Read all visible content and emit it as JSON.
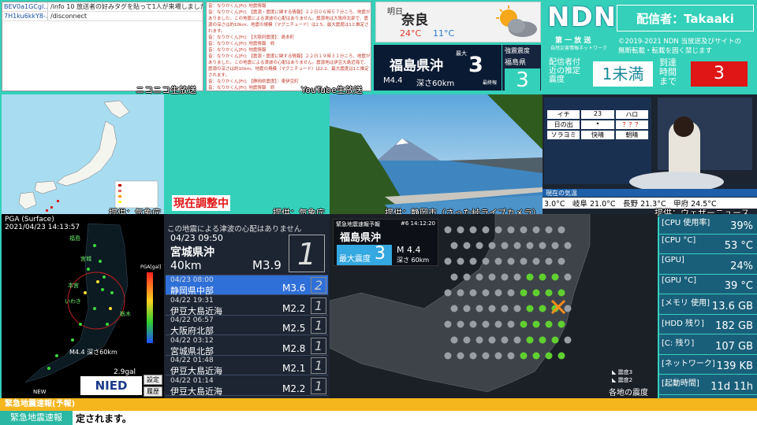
{
  "chat": {
    "rows": [
      {
        "user": "BEV0a1GCgI...",
        "text": "/info 10 放送者の好みタグを貼って1人が来場しました"
      },
      {
        "user": "7H1ku6kkY8-...",
        "text": "/disconnect"
      }
    ]
  },
  "niconico_caption": "ニコニコ生放送",
  "youtube": {
    "caption": "YouTube生放送",
    "lines": [
      "音：なりかくん[Fr]: 地震情報",
      "音：なりかくん[Fr]: 【震源・震度に関する情報】２２日０６時５７分ころ、地震がありました。この地震による津波の心配はありません。震源地は大阪府北部で、震源の深さは約10km、地震の規模（マグニチュード）は2.5、最大震度は1と推定されます。",
      "音：なりかくん[Fr]: 【大阪府震度】：島本町",
      "音：なりかくん[Fr]: 地震情報　終",
      "音：なりかくん[Fr]: 地震情報",
      "音：なりかくん[Fr]: 【震源・震度に関する情報】２２日１９時３１分ころ、地震がありました。この地震による津波の心配はありません。震源地は伊豆大島近海で、震源の深さは約10km、地震の規模（マグニチュード）は2.2、最大震度は1と推定されます。",
      "音：なりかくん[Fr]: 【静岡県震度】：東伊豆町",
      "音：なりかくん[Fr]: 地震情報　終"
    ]
  },
  "weather": {
    "label": "明日",
    "city": "奈良",
    "high": "24°C",
    "low": "11°C",
    "icon": "partly-cloudy-icon"
  },
  "eq_banner": {
    "region": "福島県沖",
    "max_label": "最大",
    "intensity": "3",
    "mag": "M4.4",
    "depth": "深さ60km",
    "final": "最終報",
    "strong_label": "強震震度",
    "strong_region": "福島県",
    "strong_value": "3"
  },
  "ndn": {
    "logo": "NDN",
    "sub1": "第 一 放 送",
    "sub2": "自然災害情報ネットワーク",
    "broadcaster": "配信者：Takaaki",
    "copyright": "©2019-2021 NDN 当放送及びサイトの",
    "copyright2": "無断転載・転載を固く禁じます",
    "est_label": "配信者付近の推定震度",
    "est_value": "1未満",
    "arrival_label": "到達時間まで",
    "arrival_value": "3"
  },
  "map_caption": "提供：気象庁",
  "adjusting": "現在調整中",
  "green_caption": "提供：気象庁",
  "cam_caption": "提供：静岡市（さった峠ライブカメラ）",
  "tv": {
    "caption": "提供：ウェザーニュース",
    "strip": "現在の気温",
    "temps": "3.0°C　岐阜 21.0°C　長野 21.3°C　甲府 24.5°C",
    "board": [
      [
        "イチ",
        "23",
        "ハロ"
      ],
      [
        "日の出",
        "•",
        "？？？"
      ],
      [
        "ソラヨミ",
        "快晴",
        "朝晴"
      ]
    ]
  },
  "pga": {
    "title": "PGA (Surface)",
    "time": "2021/04/23 14:13:57",
    "axis": "PGA[gal]",
    "mag": "M4.4 深さ60km",
    "val": "2.9gal",
    "new": "NEW",
    "logo": "NIED",
    "btn1": "設定",
    "btn2": "履歴",
    "labels": [
      "福島",
      "福島",
      "宮城",
      "郡山",
      "本宮",
      "宮城",
      "平田",
      "福島",
      "いわき",
      "日立",
      "深さ",
      "福島県沖",
      "栃木",
      "茨城"
    ]
  },
  "history": {
    "notice": "この地震による津波の心配はありません",
    "main": {
      "date": "04/23 09:50",
      "region": "宮城県沖",
      "depth": "40km",
      "mag": "M3.9",
      "intensity": "1"
    },
    "rows": [
      {
        "date": "04/23 08:00",
        "region": "静岡県中部",
        "mag": "M3.6",
        "intensity": "2"
      },
      {
        "date": "04/22 19:31",
        "region": "伊豆大島近海",
        "mag": "M2.2",
        "intensity": "1"
      },
      {
        "date": "04/22 06:57",
        "region": "大阪府北部",
        "mag": "M2.5",
        "intensity": "1"
      },
      {
        "date": "04/22 03:12",
        "region": "宮城県北部",
        "mag": "M2.8",
        "intensity": "1"
      },
      {
        "date": "04/22 01:48",
        "region": "伊豆大島近海",
        "mag": "M2.1",
        "intensity": "1"
      },
      {
        "date": "04/22 01:14",
        "region": "伊豆大島近海",
        "mag": "M2.2",
        "intensity": "1"
      }
    ]
  },
  "eew": {
    "header": "緊急地震速報予報",
    "sub": "#6 14:12:20",
    "region": "福島県沖",
    "max_label": "最大震度",
    "intensity": "3",
    "mag": "M 4.4",
    "depth": "深さ 60km",
    "legend1": "震度3",
    "legend2": "震度2",
    "footer_label": "各地の震度"
  },
  "system": [
    {
      "k": "[CPU 使用率]",
      "v": "39%"
    },
    {
      "k": "[CPU °C]",
      "v": "53 °C"
    },
    {
      "k": "[GPU]",
      "v": "24%"
    },
    {
      "k": "[GPU °C]",
      "v": "39 °C"
    },
    {
      "k": "[メモリ 使用]",
      "v": "13.6 GB"
    },
    {
      "k": "[HDD 残り]",
      "v": "182 GB"
    },
    {
      "k": "[C: 残り]",
      "v": "107 GB"
    },
    {
      "k": "[ネットワーク]",
      "v": "139 KB"
    },
    {
      "k": "[起動時間]",
      "v": "11d 11h"
    }
  ],
  "footer": {
    "top": "緊急地震速報(予報)",
    "tag": "緊急地震速報",
    "ticker": "定されます。"
  }
}
